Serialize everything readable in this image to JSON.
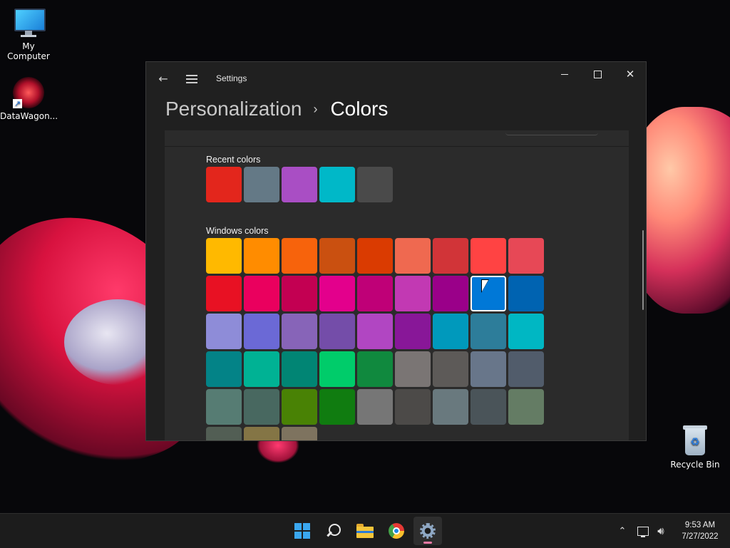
{
  "desktop": {
    "icons": [
      {
        "label": "My Computer"
      },
      {
        "label": "DataWagon..."
      },
      {
        "label": "Recycle Bin"
      }
    ]
  },
  "window": {
    "title": "Settings",
    "breadcrumb": {
      "parent": "Personalization",
      "separator": "›",
      "current": "Colors"
    }
  },
  "recent_colors": {
    "label": "Recent colors",
    "swatches": [
      "#e3261c",
      "#647986",
      "#a94ec4",
      "#00b8c8",
      "#4a4a4a"
    ]
  },
  "windows_colors": {
    "label": "Windows colors",
    "selected": "#0078d7",
    "rows": [
      [
        "#ffb900",
        "#ff8c00",
        "#f7630c",
        "#ca5010",
        "#da3b01",
        "#ef6950",
        "#d13438",
        "#ff4343",
        "#e74856"
      ],
      [
        "#e81123",
        "#ea005e",
        "#c30052",
        "#e3008c",
        "#bf0077",
        "#c239b3",
        "#9a0089",
        "#0078d7",
        "#0063b1"
      ],
      [
        "#8e8cd8",
        "#6b69d6",
        "#8764b8",
        "#744da9",
        "#b146c2",
        "#881798",
        "#0099bc",
        "#2d7d9a",
        "#00b7c3"
      ],
      [
        "#038387",
        "#00b294",
        "#018574",
        "#00cc6a",
        "#10893e",
        "#7a7574",
        "#5d5a58",
        "#68768a",
        "#515c6b"
      ],
      [
        "#567c73",
        "#486860",
        "#498205",
        "#107c10",
        "#767676",
        "#4c4a48",
        "#69797e",
        "#4a5459",
        "#647c64"
      ],
      [
        "#525e54",
        "#847545",
        "#7e735f"
      ]
    ]
  },
  "taskbar": {
    "apps": [
      "start",
      "search",
      "file-explorer",
      "chrome",
      "settings"
    ],
    "active": "settings",
    "indicator_color": "#f27aa6",
    "time": "9:53 AM",
    "date": "7/27/2022"
  }
}
